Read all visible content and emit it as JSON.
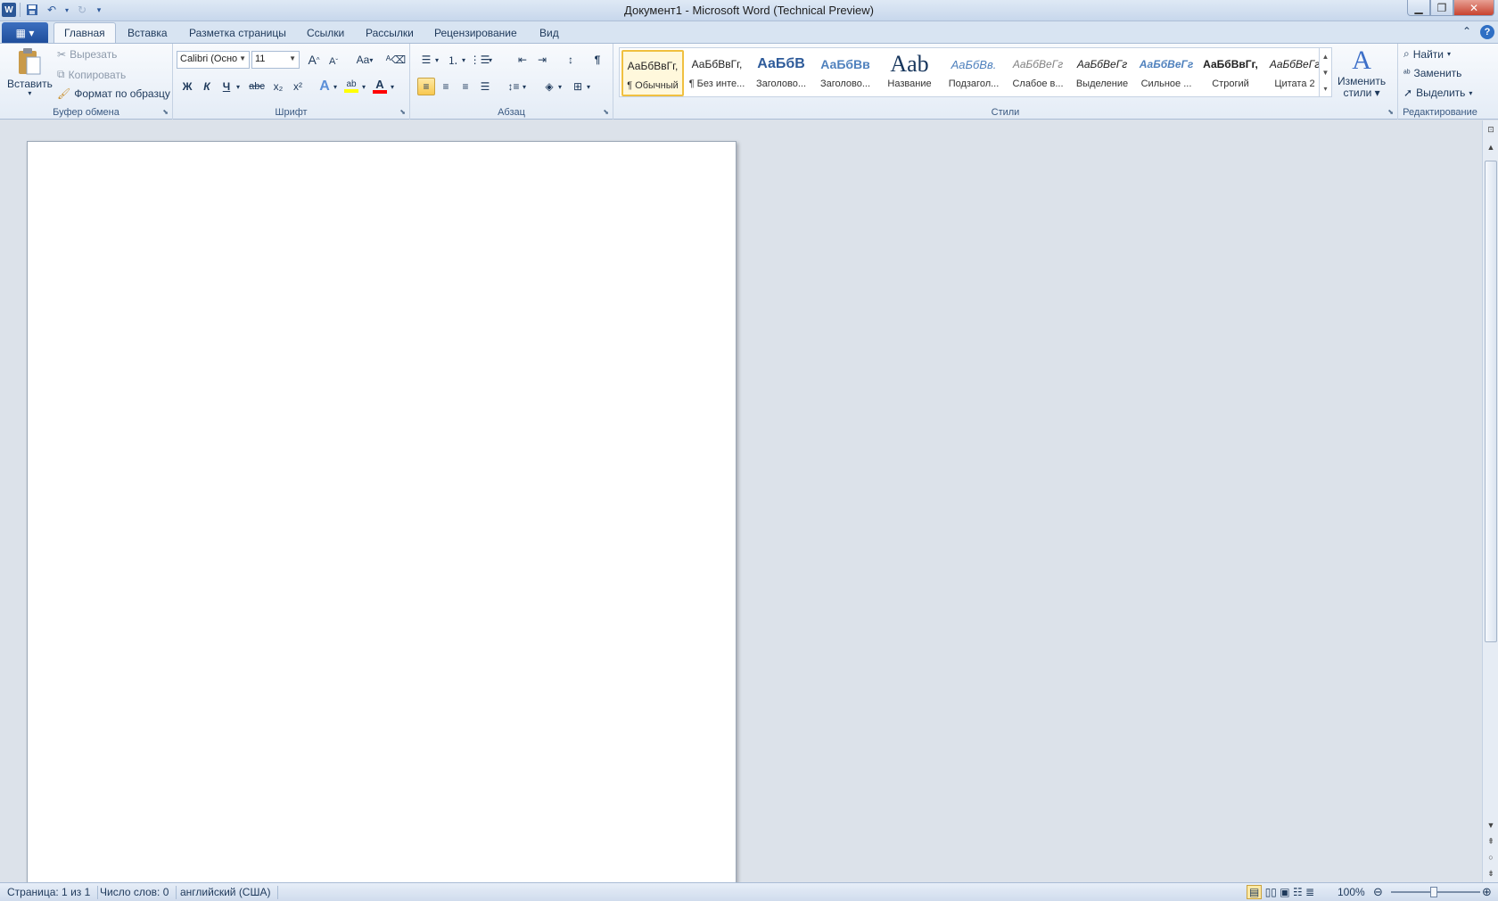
{
  "window": {
    "title": "Документ1  -  Microsoft Word (Technical Preview)"
  },
  "qat": {
    "app_icon": "word-icon",
    "save_icon": "save-icon",
    "undo_icon": "undo-icon",
    "redo_icon": "redo-icon",
    "customize_icon": "customize-qat-icon"
  },
  "tabs": {
    "file_icon": "file-menu-icon",
    "items": [
      "Главная",
      "Вставка",
      "Разметка страницы",
      "Ссылки",
      "Рассылки",
      "Рецензирование",
      "Вид"
    ],
    "active": "Главная"
  },
  "clipboard": {
    "paste": "Вставить",
    "cut": "Вырезать",
    "copy": "Копировать",
    "format_painter": "Формат по образцу",
    "label": "Буфер обмена"
  },
  "font": {
    "family": "Calibri (Осно",
    "size": "11",
    "grow": "A",
    "shrink": "A",
    "change_case": "Aa",
    "bold": "Ж",
    "italic": "К",
    "underline": "Ч",
    "strike": "abc",
    "subscript": "x₂",
    "superscript": "x²",
    "label": "Шрифт",
    "highlight_color": "#ffff00",
    "font_color": "#ff0000"
  },
  "paragraph": {
    "label": "Абзац",
    "pilcrow": "¶"
  },
  "styles": {
    "label": "Стили",
    "items": [
      {
        "preview": "АаБбВвГг,",
        "name": "¶ Обычный"
      },
      {
        "preview": "АаБбВвГг,",
        "name": "¶ Без инте..."
      },
      {
        "preview": "АаБбВ",
        "name": "Заголово..."
      },
      {
        "preview": "АаБбВв",
        "name": "Заголово..."
      },
      {
        "preview": "Aab",
        "name": "Название"
      },
      {
        "preview": "АаБбВв.",
        "name": "Подзагол..."
      },
      {
        "preview": "АаБбВеГг",
        "name": "Слабое в..."
      },
      {
        "preview": "АаБбВеГг",
        "name": "Выделение"
      },
      {
        "preview": "АаБбВеГг",
        "name": "Сильное ..."
      },
      {
        "preview": "АаБбВвГг,",
        "name": "Строгий"
      },
      {
        "preview": "АаБбВеГг",
        "name": "Цитата 2"
      }
    ],
    "change_styles_line1": "Изменить",
    "change_styles_line2": "стили"
  },
  "editing": {
    "label": "Редактирование",
    "find": "Найти",
    "replace": "Заменить",
    "select": "Выделить"
  },
  "status": {
    "page": "Страница: 1 из 1",
    "words": "Число слов: 0",
    "language": "английский (США)",
    "zoom": "100%"
  }
}
